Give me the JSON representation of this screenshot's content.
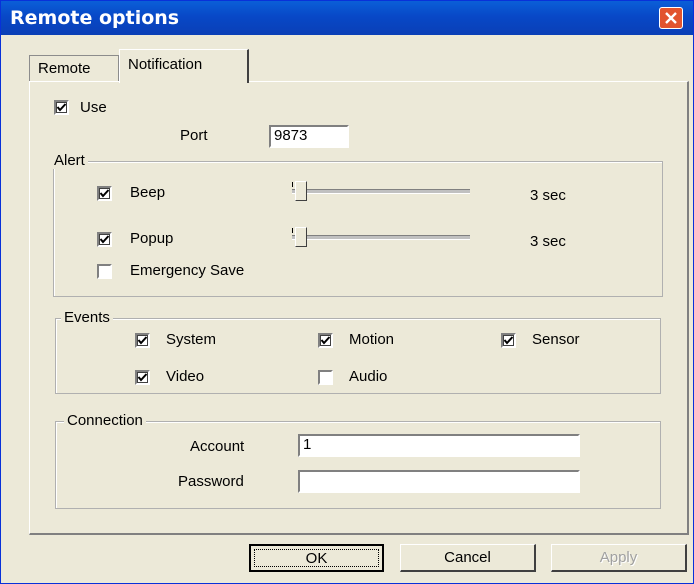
{
  "window": {
    "title": "Remote options"
  },
  "tabs": [
    {
      "label": "Remote"
    },
    {
      "label": "Notification"
    }
  ],
  "use": {
    "label": "Use",
    "checked": true
  },
  "port": {
    "label": "Port",
    "value": "9873"
  },
  "alert": {
    "title": "Alert",
    "beep": {
      "label": "Beep",
      "checked": true,
      "value_label": "3 sec",
      "slider_level": 0.02
    },
    "popup": {
      "label": "Popup",
      "checked": true,
      "value_label": "3 sec",
      "slider_level": 0.02
    },
    "emergency": {
      "label": "Emergency Save",
      "checked": false
    }
  },
  "events": {
    "title": "Events",
    "items": [
      {
        "label": "System",
        "checked": true
      },
      {
        "label": "Motion",
        "checked": true
      },
      {
        "label": "Sensor",
        "checked": true
      },
      {
        "label": "Video",
        "checked": true
      },
      {
        "label": "Audio",
        "checked": false
      }
    ]
  },
  "connection": {
    "title": "Connection",
    "account_label": "Account",
    "account_value": "1",
    "password_label": "Password",
    "password_value": ""
  },
  "buttons": {
    "ok": "OK",
    "cancel": "Cancel",
    "apply": "Apply"
  },
  "colors": {
    "title_bar": "#0848c7",
    "close_button": "#e2542f",
    "dialog_bg": "#ece9d8"
  }
}
